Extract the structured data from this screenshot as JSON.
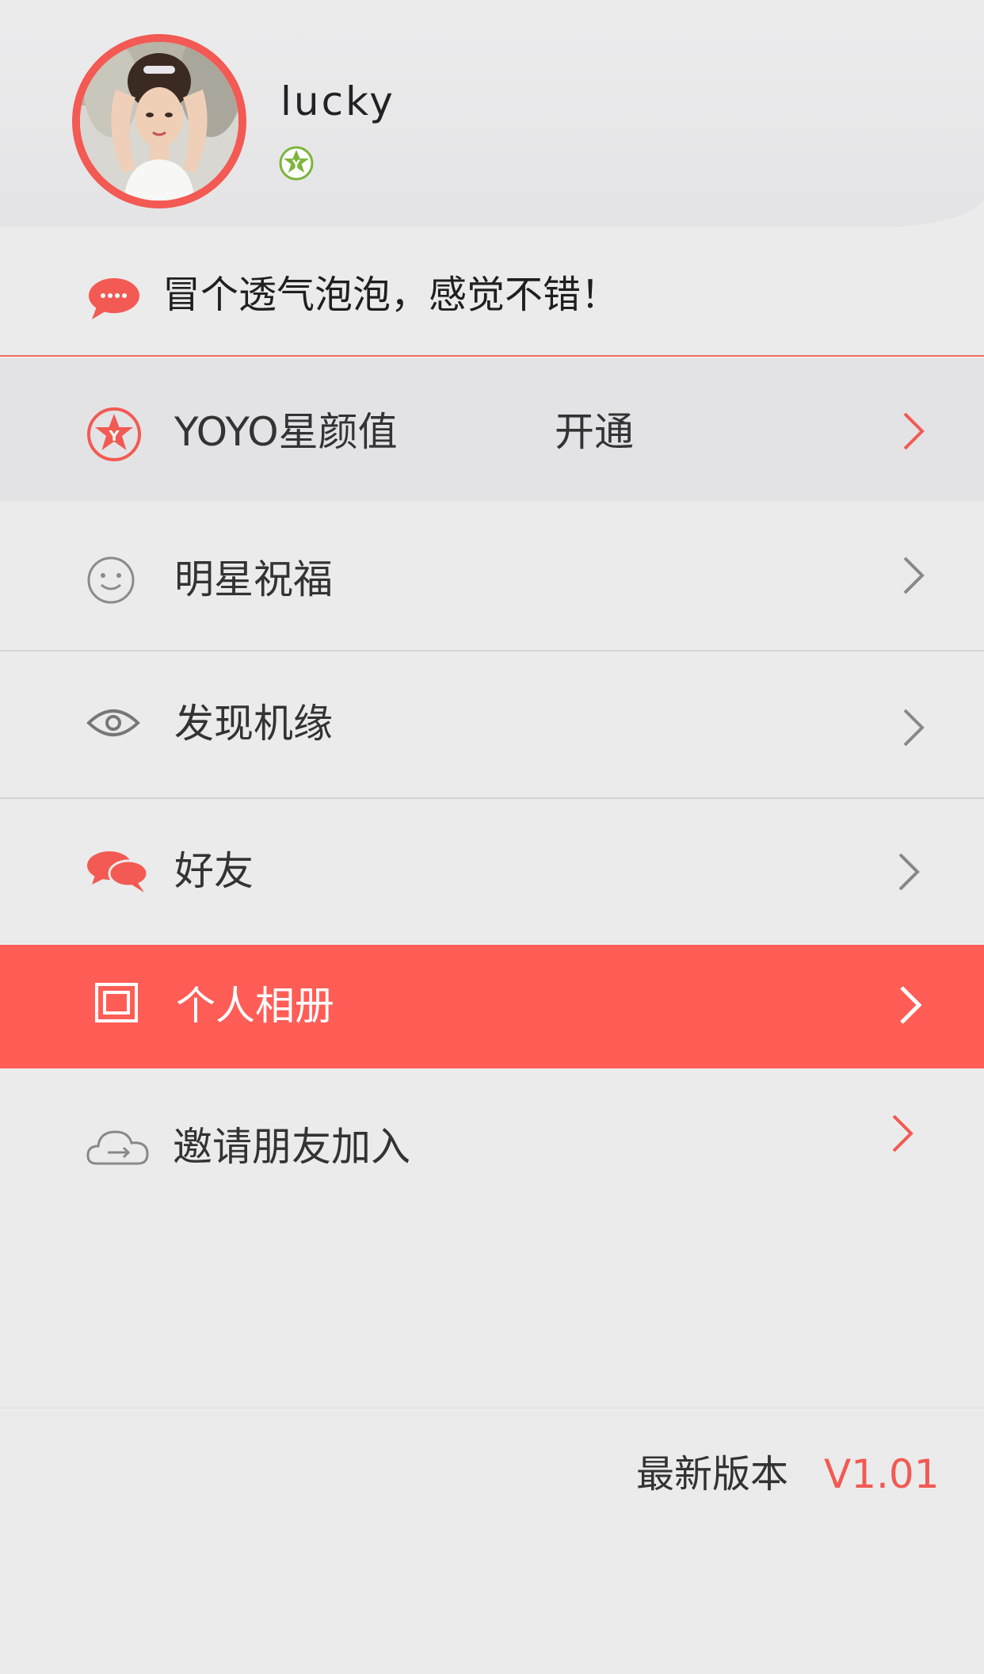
{
  "profile": {
    "username": "lucky",
    "avatar_icon": "user-photo",
    "badge_icon": "yoyo-star-badge",
    "accent_color": "#f25a53"
  },
  "signature": {
    "text": "冒个透气泡泡，感觉不错！",
    "icon": "chat-bubble-icon"
  },
  "menu": [
    {
      "label": "YOYO星颜值",
      "extra": "开通",
      "icon": "yoyo-star-icon"
    },
    {
      "label": "明星祝福",
      "icon": "smile-icon"
    },
    {
      "label": "发现机缘",
      "icon": "eye-icon"
    },
    {
      "label": "好友",
      "icon": "chat-bubbles-icon"
    },
    {
      "label": "个人相册",
      "icon": "album-icon"
    },
    {
      "label": "邀请朋友加入",
      "icon": "cloud-arrow-icon"
    }
  ],
  "footer": {
    "version_label": "最新版本",
    "version_value": "V1.01"
  },
  "colors": {
    "accent": "#f25a53",
    "highlight_row": "#ff5d56",
    "badge_green": "#7bb53a"
  }
}
